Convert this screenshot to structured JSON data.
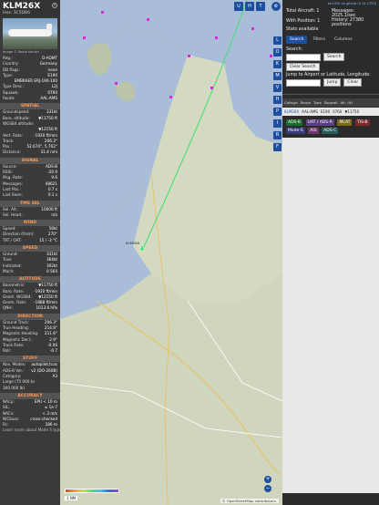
{
  "panel": {
    "callsign": "KLM26X",
    "hex_line": "Hex: 3C5DB6",
    "photo_credit": "Image © Rosse Kanich",
    "close_icon": "close-icon",
    "info": [
      {
        "k": "Reg.:",
        "v": "D-AQMT"
      },
      {
        "k": "Country:",
        "v": "Germany"
      },
      {
        "k": "DB flags:",
        "v": "none"
      },
      {
        "k": "Type:",
        "v": "E190"
      },
      {
        "k": "",
        "v": "EMBRAER ERJ-190-100"
      },
      {
        "k": "Type Desc.:",
        "v": "L2J"
      },
      {
        "k": "Squawk:",
        "v": "0760"
      },
      {
        "k": "Route:",
        "v": "AAL-AMS"
      }
    ],
    "spatial_title": "SPATIAL",
    "spatial": [
      {
        "k": "Groundspeed:",
        "v": "331kt"
      },
      {
        "k": "Baro. altitude:",
        "v": "▼11750 ft"
      },
      {
        "k": "WGS84 altitude:",
        "v": ""
      },
      {
        "k": "",
        "v": "▼12150 ft"
      },
      {
        "k": "Vert. Rate:",
        "v": "-1920 ft/min"
      },
      {
        "k": "Track:",
        "v": "206.3°"
      },
      {
        "k": "Pos.:",
        "v": "52.674°, 5.702°"
      },
      {
        "k": "Distance:",
        "v": "31.4 nmi"
      }
    ],
    "signal_title": "SIGNAL",
    "signal": [
      {
        "k": "Source:",
        "v": "ADS-B"
      },
      {
        "k": "RSSI:",
        "v": "-20.9"
      },
      {
        "k": "Msg. Rate:",
        "v": "9.6"
      },
      {
        "k": "Messages:",
        "v": "48621"
      },
      {
        "k": "Last Pos.:",
        "v": "0.7 s"
      },
      {
        "k": "Last Seen:",
        "v": "0.1 s"
      }
    ],
    "fms_title": "FMS SEL",
    "fms": [
      {
        "k": "Sel. Alt.:",
        "v": "10000 ft"
      },
      {
        "k": "Sel. Head.:",
        "v": "n/a"
      }
    ],
    "wind_title": "WIND",
    "wind": [
      {
        "k": "Speed:",
        "v": "56kt"
      },
      {
        "k": "Direction (from):",
        "v": "270°"
      },
      {
        "k": "TAT / OAT:",
        "v": "15 / -3 °C"
      }
    ],
    "speed_title": "SPEED",
    "speed": [
      {
        "k": "Ground:",
        "v": "331kt"
      },
      {
        "k": "True:",
        "v": "364kt"
      },
      {
        "k": "Indicated:",
        "v": "302kt"
      },
      {
        "k": "Mach:",
        "v": "0.564"
      }
    ],
    "alt_title": "ALTITUDE",
    "alt": [
      {
        "k": "Barometric:",
        "v": "▼11750 ft"
      },
      {
        "k": "Baro. Rate:",
        "v": "-1920 ft/min"
      },
      {
        "k": "Geom. WGS84:",
        "v": "▼12150 ft"
      },
      {
        "k": "Geom. Rate:",
        "v": "-1888 ft/min"
      },
      {
        "k": "QNH:",
        "v": "1013.6 hPa"
      }
    ],
    "dir_title": "DIRECTION",
    "dir": [
      {
        "k": "Ground Track:",
        "v": "206.3°"
      },
      {
        "k": "True Heading:",
        "v": "214.8°"
      },
      {
        "k": "Magnetic Heading:",
        "v": "211.6°"
      },
      {
        "k": "Magnetic Decl.:",
        "v": "2.9°"
      },
      {
        "k": "Track Rate:",
        "v": "-0.06"
      },
      {
        "k": "Roll:",
        "v": "-0.7"
      }
    ],
    "stuff_title": "STUFF",
    "stuff": [
      {
        "k": "Nav. Modes:",
        "v": "autopilot,tcas"
      },
      {
        "k": "ADS-B Ver.:",
        "v": "v2 (DO-260B)"
      },
      {
        "k": "Category:",
        "v": "A3"
      },
      {
        "k": "Large (75 000 to",
        "v": ""
      },
      {
        "k": "300 000 lb)",
        "v": ""
      }
    ],
    "acc_title": "ACCURACY",
    "acc": [
      {
        "k": "NACp:",
        "v": "EPU < 10 m"
      },
      {
        "k": "SIL:",
        "v": "≤ 1e-7"
      },
      {
        "k": "NACv:",
        "v": "< 3 m/s"
      },
      {
        "k": "NICbaro:",
        "v": "cross-checked"
      },
      {
        "k": "Rc:",
        "v": "186 m"
      }
    ],
    "footer": "Learn more about Mode S type by hovering over"
  },
  "map": {
    "top_buttons": [
      "U",
      "H",
      "T"
    ],
    "side_buttons": [
      "L",
      "O",
      "K",
      "M",
      "V",
      "H",
      "P",
      "I",
      "R",
      "F"
    ],
    "plus": "+",
    "minus": "−",
    "scale": "1 NM",
    "attribution": "© OpenStreetMap contributors.",
    "aircraft_label": "KLM26X"
  },
  "sidebar": {
    "version_link": "tar1090 on github (3.14.1753)",
    "total_aircraft": "Total Aircraft: 1",
    "with_position": "With Position: 1",
    "stats_available": "Stats available",
    "messages_label": "Messages:",
    "messages_rate": "2025.1/sec",
    "history_label": "History: 27380",
    "history_positions": "positions",
    "tabs": [
      "Search",
      "Filters",
      "Columns"
    ],
    "search_label": "Search:",
    "search_button": "Search",
    "clear_search": "Clear Search",
    "jump_label": "Jump to Airport or Latitude, Longitude:",
    "jump_button": "Jump",
    "clear_button": "Clear",
    "table_headers": [
      "Callsign",
      "Route",
      "Type",
      "Squawk",
      "Alt. (ft)"
    ],
    "table_row": [
      "KLM26X",
      "AAL-AMS",
      "E190",
      "0760",
      "▼11750"
    ],
    "chips": [
      "ADS-B",
      "UAT / ADS-R",
      "MLAT",
      "TIS-B",
      "Mode-S",
      "AIS",
      "ADS-C"
    ],
    "chip_colors": [
      "#1e6a2e",
      "#5a3f7f",
      "#7c6a1e",
      "#7f2a2a",
      "#3a3a7a",
      "#6a3a6a",
      "#2a5a5a"
    ]
  }
}
